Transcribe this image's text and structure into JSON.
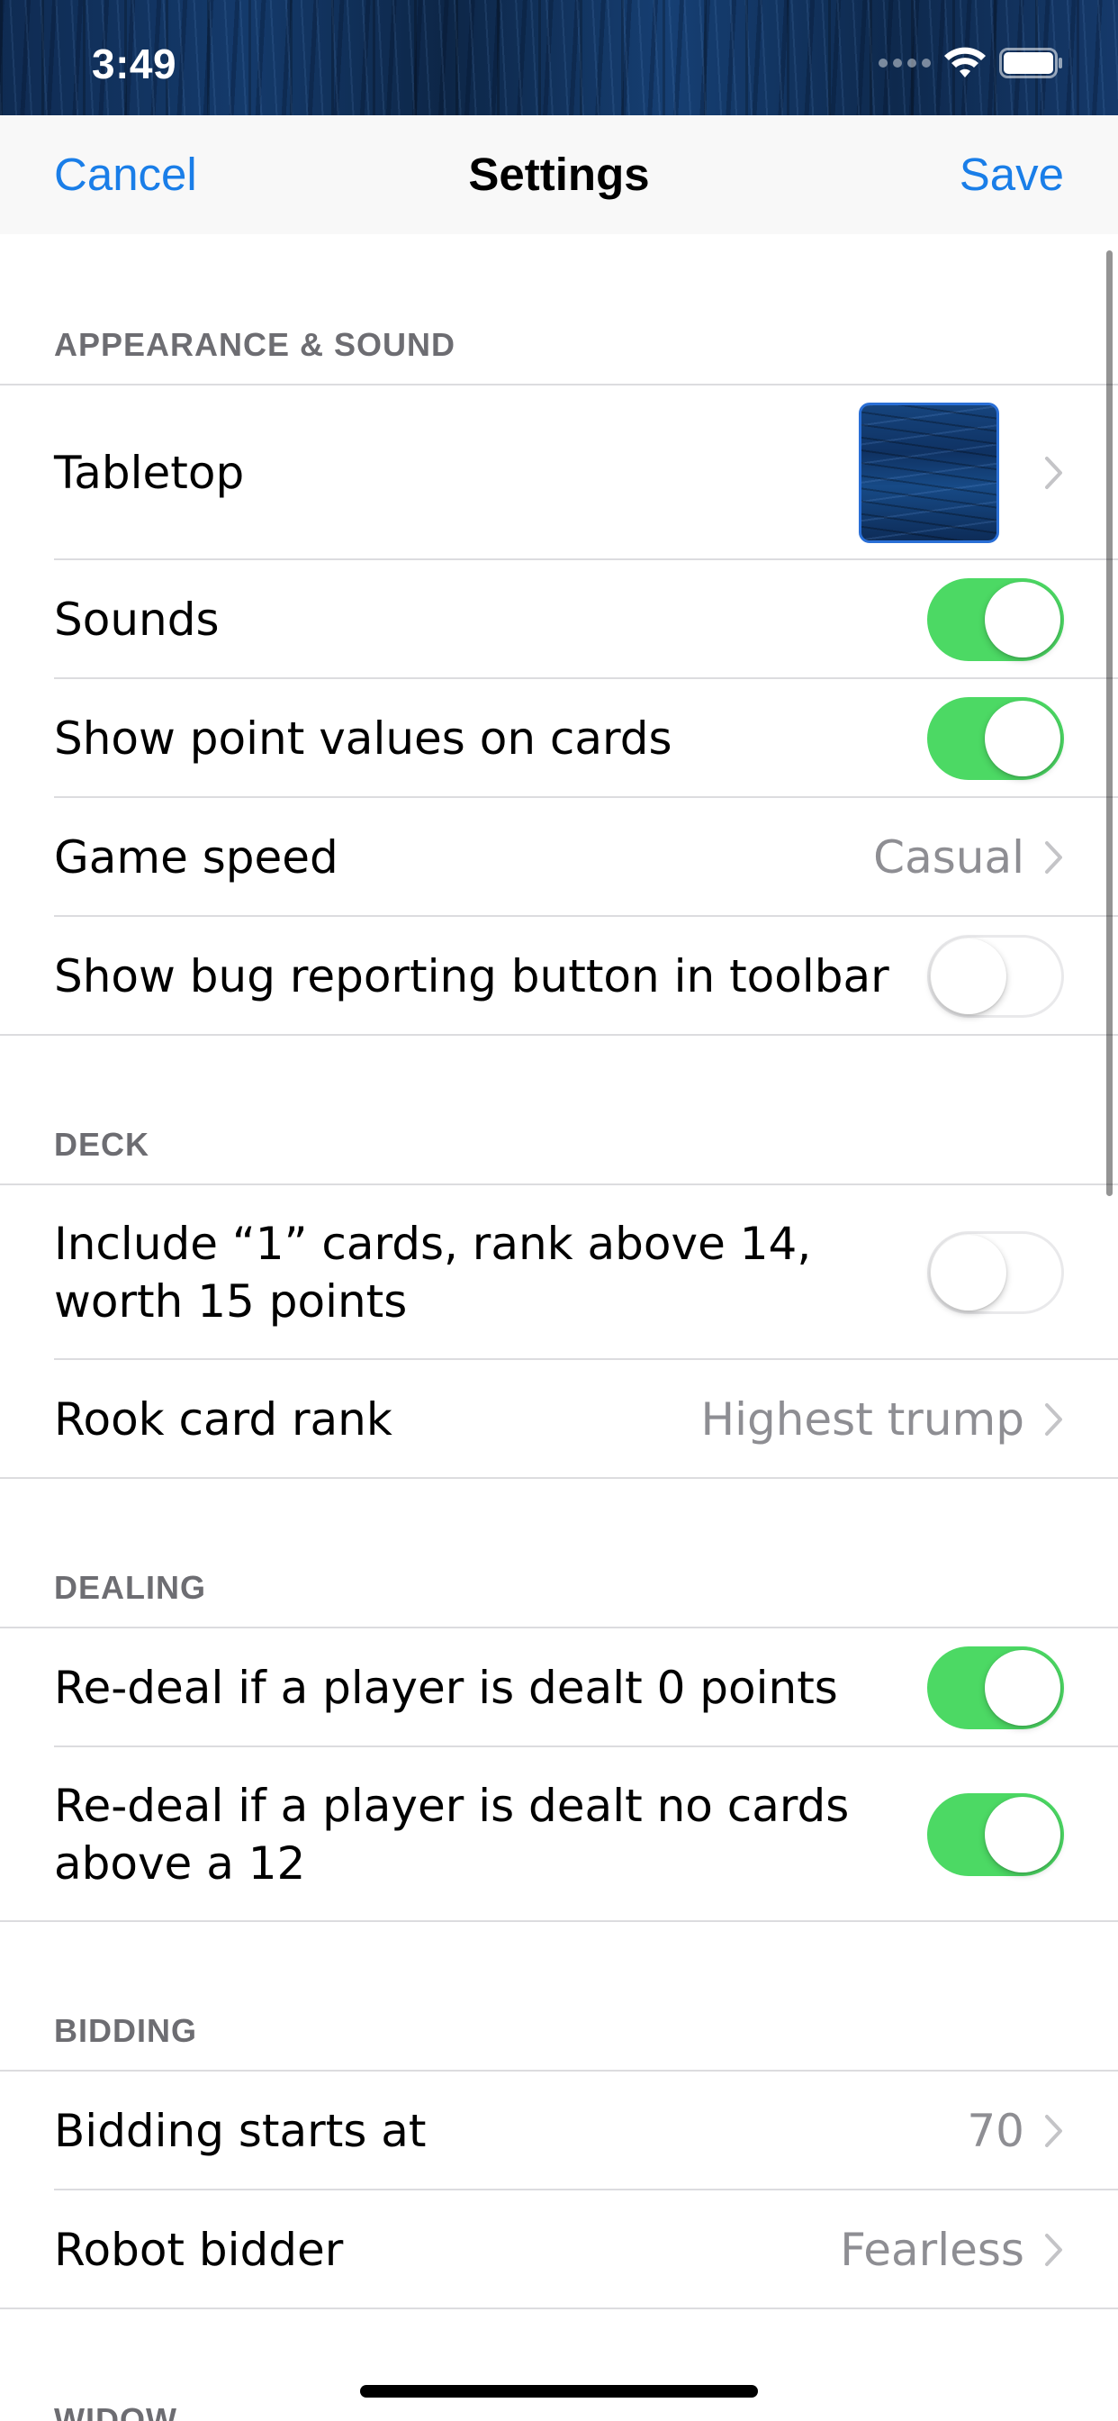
{
  "status_bar": {
    "time": "3:49"
  },
  "nav": {
    "cancel_label": "Cancel",
    "title": "Settings",
    "save_label": "Save"
  },
  "colors": {
    "accent": "#1a7ee8",
    "toggle_on": "#4cd964",
    "secondary_text": "#8e8e93",
    "section_header": "#6d6d72"
  },
  "sections": {
    "appearance": {
      "header": "APPEARANCE & SOUND",
      "tabletop": {
        "label": "Tabletop"
      },
      "sounds": {
        "label": "Sounds",
        "on": true
      },
      "point_values": {
        "label": "Show point values on cards",
        "on": true
      },
      "game_speed": {
        "label": "Game speed",
        "value": "Casual"
      },
      "bug_button": {
        "label": "Show bug reporting button in toolbar",
        "on": false
      }
    },
    "deck": {
      "header": "DECK",
      "one_cards": {
        "label": "Include “1” cards, rank above 14, worth 15 points",
        "on": false
      },
      "rook_rank": {
        "label": "Rook card rank",
        "value": "Highest trump"
      }
    },
    "dealing": {
      "header": "DEALING",
      "redeal_zero": {
        "label": "Re-deal if a player is dealt 0 points",
        "on": true
      },
      "redeal_twelve": {
        "label": "Re-deal if a player is dealt no cards above a 12",
        "on": true
      }
    },
    "bidding": {
      "header": "BIDDING",
      "starts_at": {
        "label": "Bidding starts at",
        "value": "70"
      },
      "robot_bidder": {
        "label": "Robot bidder",
        "value": "Fearless"
      }
    },
    "widow": {
      "header": "WIDOW"
    }
  }
}
